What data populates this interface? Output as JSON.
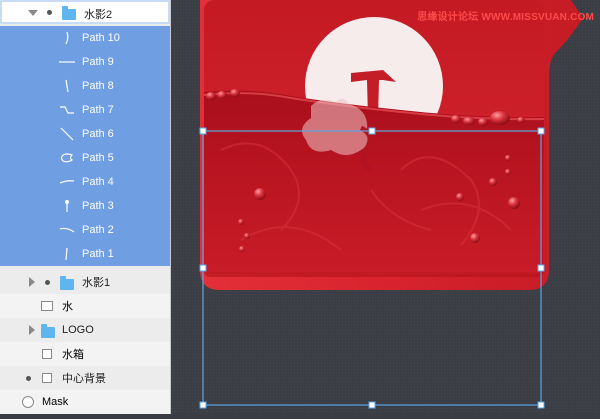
{
  "watermark": "思缘设计论坛 WWW.MISSVUAN.COM",
  "layers": {
    "group_water_shadow_2": "水影2",
    "paths": [
      "Path 10",
      "Path 9",
      "Path 8",
      "Path 7",
      "Path 6",
      "Path 5",
      "Path 4",
      "Path 3",
      "Path 2",
      "Path 1"
    ],
    "group_water_shadow_1": "水影1",
    "water": "水",
    "logo": "LOGO",
    "tank": "水箱",
    "center_bg": "中心背景",
    "mask": "Mask"
  },
  "colors": {
    "selection": "#6f9ee2",
    "folder": "#5fb6ef",
    "tank_red": "#d8232d",
    "water_red": "#b5121e",
    "selection_outline": "#5aa7e6"
  }
}
